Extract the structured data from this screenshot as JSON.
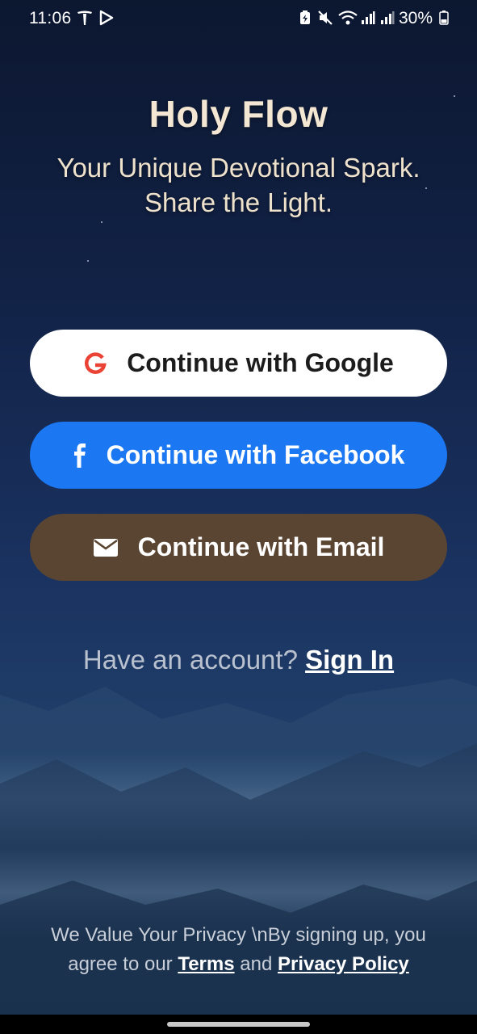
{
  "status_bar": {
    "time": "11:06",
    "battery": "30%",
    "icons": [
      "tesla-icon",
      "play-store-icon",
      "battery-saver-icon",
      "mute-icon",
      "wifi-icon",
      "signal-icon",
      "signal-icon",
      "battery-icon"
    ]
  },
  "header": {
    "title": "Holy Flow",
    "tagline_line1": "Your Unique Devotional Spark.",
    "tagline_line2": "Share the Light."
  },
  "auth": {
    "google_label": "Continue with Google",
    "facebook_label": "Continue with Facebook",
    "email_label": "Continue with Email"
  },
  "signin": {
    "prompt": "Have an account?",
    "link": "Sign In"
  },
  "privacy": {
    "text": "We Value Your Privacy \\nBy signing up, you agree to our",
    "terms": "Terms",
    "and": "and",
    "policy": "Privacy Policy"
  },
  "colors": {
    "google_bg": "#ffffff",
    "facebook_bg": "#1b77f2",
    "email_bg": "#5a4532",
    "title": "#f3e6d2",
    "google_red": "#ea4335"
  }
}
